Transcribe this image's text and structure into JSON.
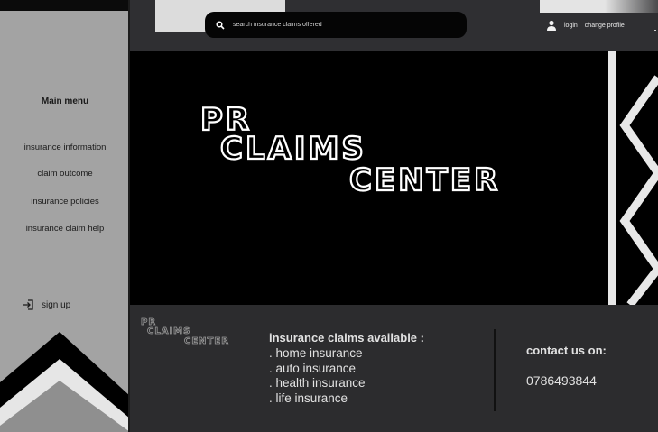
{
  "search": {
    "placeholder": "search insurance claims offered"
  },
  "user": {
    "login_label": "login",
    "change_profile_label": "change profile"
  },
  "sidebar": {
    "title": "Main  menu",
    "items": [
      {
        "label": "insurance information"
      },
      {
        "label": "claim outcome"
      },
      {
        "label": "insurance policies"
      },
      {
        "label": "insurance claim help"
      }
    ],
    "signup_label": "sign up"
  },
  "brand": {
    "line1": "PR",
    "line2": "CLAIMS",
    "line3": "CENTER"
  },
  "claims": {
    "heading": "insurance claims available :",
    "items": [
      ". home insurance",
      ". auto insurance",
      ". health insurance",
      ". life insurance"
    ]
  },
  "contact": {
    "title": "contact us on:",
    "phone": "0786493844"
  },
  "colors": {
    "sidebar_bg": "#a3a3a3",
    "topbar_bg": "#2f2f32",
    "hero_bg": "#000000",
    "footer_bg": "#2c2c2e",
    "text_light": "#e2e2e2"
  }
}
